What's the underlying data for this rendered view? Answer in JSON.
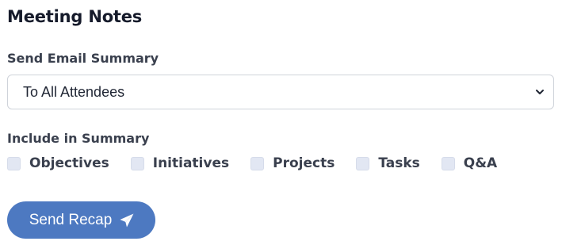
{
  "page": {
    "title": "Meeting Notes"
  },
  "email_summary": {
    "label": "Send Email Summary",
    "selected": "To All Attendees",
    "icon": "chevron-down-icon"
  },
  "include": {
    "label": "Include in Summary",
    "options": [
      {
        "label": "Objectives",
        "checked": false
      },
      {
        "label": "Initiatives",
        "checked": false
      },
      {
        "label": "Projects",
        "checked": false
      },
      {
        "label": "Tasks",
        "checked": false
      },
      {
        "label": "Q&A",
        "checked": false
      }
    ]
  },
  "actions": {
    "send_label": "Send Recap",
    "send_icon": "paper-plane-icon"
  },
  "colors": {
    "accent": "#4d79c1",
    "checkbox_fill": "#e2e7f3",
    "text": "#1f2533"
  }
}
